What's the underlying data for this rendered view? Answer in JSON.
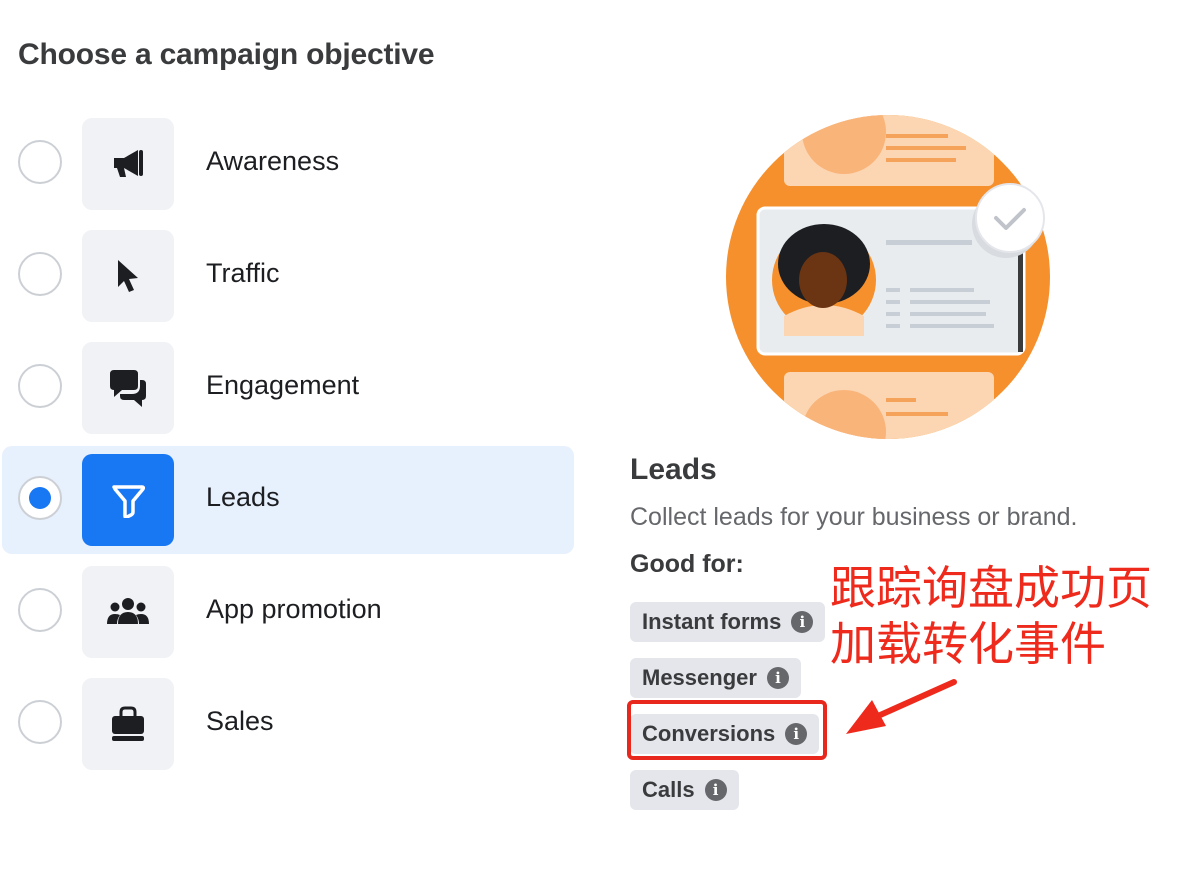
{
  "page": {
    "title": "Choose a campaign objective"
  },
  "objectives": [
    {
      "label": "Awareness",
      "icon": "megaphone-icon",
      "selected": false
    },
    {
      "label": "Traffic",
      "icon": "cursor-icon",
      "selected": false
    },
    {
      "label": "Engagement",
      "icon": "chat-bubbles-icon",
      "selected": false
    },
    {
      "label": "Leads",
      "icon": "funnel-icon",
      "selected": true
    },
    {
      "label": "App promotion",
      "icon": "people-icon",
      "selected": false
    },
    {
      "label": "Sales",
      "icon": "shopping-bag-icon",
      "selected": false
    }
  ],
  "detail": {
    "title": "Leads",
    "description": "Collect leads for your business or brand.",
    "good_for_label": "Good for:",
    "chips": [
      "Instant forms",
      "Messenger",
      "Conversions",
      "Calls"
    ],
    "highlighted_chip": "Conversions"
  },
  "annotation": {
    "line1": "跟踪询盘成功页",
    "line2": "加载转化事件",
    "color": "#ee2a1d"
  },
  "colors": {
    "accent": "#1877f2",
    "selected_bg": "#e7f0fd",
    "illustration_orange": "#f5902d"
  }
}
